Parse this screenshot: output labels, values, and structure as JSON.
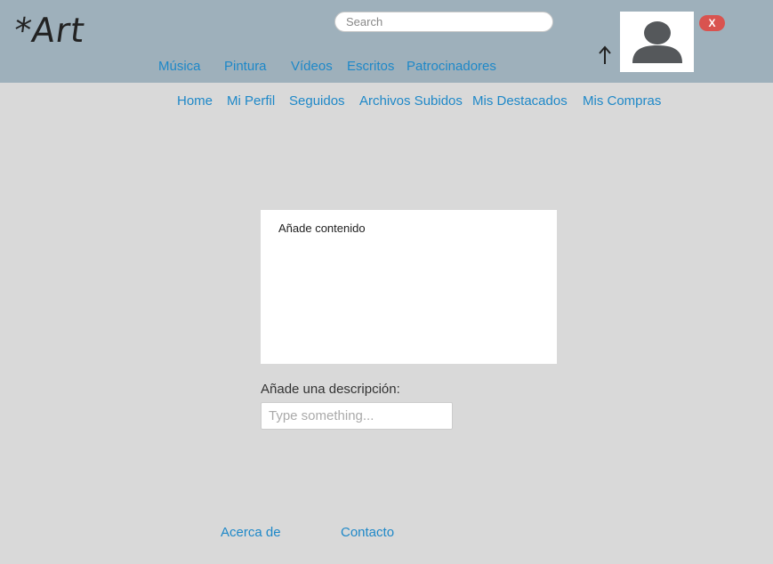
{
  "header": {
    "logo_text": "*Art",
    "search": {
      "placeholder": "Search",
      "value": ""
    },
    "upload_icon": "arrow-up-icon",
    "avatar_icon": "user-silhouette-icon",
    "close_label": "X"
  },
  "main_nav": {
    "items": [
      {
        "label": "Música"
      },
      {
        "label": "Pintura"
      },
      {
        "label": "Vídeos"
      },
      {
        "label": "Escritos"
      },
      {
        "label": "Patrocinadores"
      }
    ]
  },
  "sub_nav": {
    "items": [
      {
        "label": "Home"
      },
      {
        "label": "Mi Perfil"
      },
      {
        "label": "Seguidos"
      },
      {
        "label": "Archivos Subidos"
      },
      {
        "label": "Mis Destacados"
      },
      {
        "label": "Mis Compras"
      }
    ]
  },
  "upload": {
    "content_prompt": "Añade contenido",
    "description_label": "Añade una descripción:",
    "description_placeholder": "Type something...",
    "description_value": ""
  },
  "footer": {
    "links": [
      {
        "label": "Acerca de"
      },
      {
        "label": "Contacto"
      }
    ]
  },
  "colors": {
    "header_bg": "#9eb0bb",
    "page_bg": "#d9d9d9",
    "link": "#1e88c8",
    "close_button": "#d9534f"
  }
}
